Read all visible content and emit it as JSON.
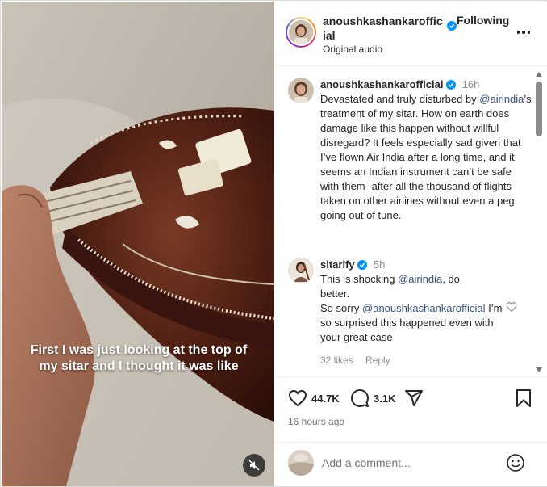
{
  "video": {
    "caption": "First I was just looking at the top of my sitar and I thought it was like"
  },
  "header": {
    "username": "anoushkashankarofficial",
    "follow_label": "Following",
    "audio_label": "Original audio"
  },
  "comments": [
    {
      "username": "anoushkashankarofficial",
      "time": "16h",
      "text_before": "Devastated and truly disturbed by ",
      "mention": "@airindia",
      "text_after": "’s treatment of my sitar. How on earth does damage like this happen without willful disregard? It feels especially sad given that I’ve flown Air India after a long time, and it seems an Indian instrument can’t be safe with them- after all the thousand of flights taken on other airlines without even a peg going out of tune."
    },
    {
      "username": "sitarify",
      "time": "5h",
      "line1_before": "This is shocking ",
      "line1_mention": "@airindia",
      "line1_after": ", do better.",
      "line2_before": "So sorry ",
      "line2_mention": "@anoushkashankarofficial",
      "line2_after": " I’m so surprised this happened even with your great case",
      "likes": "32 likes",
      "reply_label": "Reply"
    }
  ],
  "actions": {
    "like_count": "44.7K",
    "comment_count": "3.1K",
    "time_ago": "16 hours ago"
  },
  "add_comment": {
    "placeholder": "Add a comment..."
  },
  "colors": {
    "verified": "#0095f6",
    "mention": "#385185",
    "muted_text": "#8e8e8e"
  },
  "icons": [
    "mute-icon",
    "more-icon",
    "verified-icon",
    "heart-icon",
    "comment-icon",
    "share-icon",
    "bookmark-icon",
    "emoji-icon"
  ]
}
